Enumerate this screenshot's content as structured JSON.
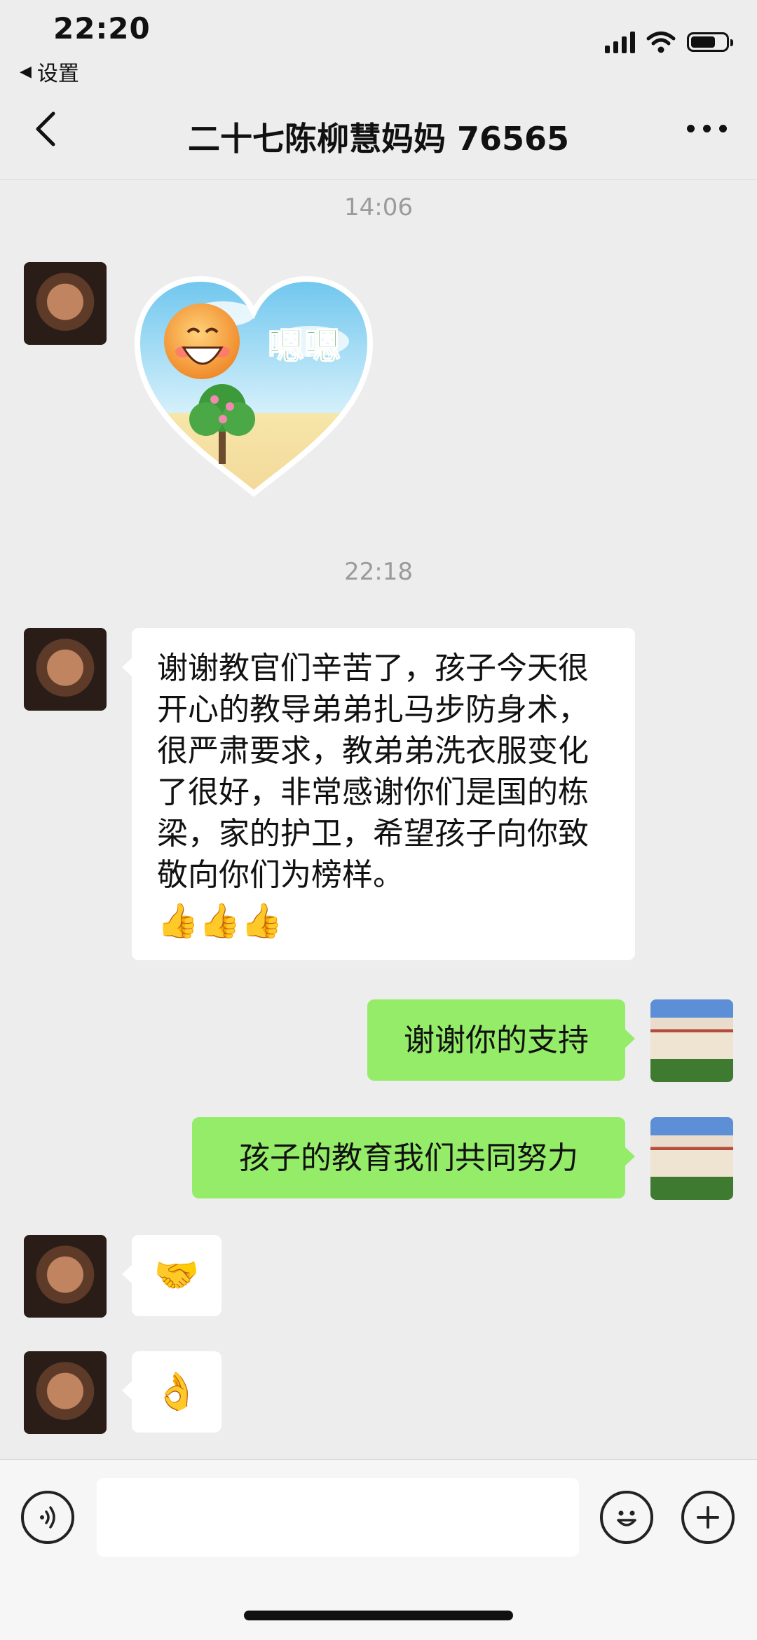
{
  "status_bar": {
    "time": "22:20",
    "back_app_label": "设置",
    "battery_level": 0.7
  },
  "nav": {
    "title": "二十七陈柳慧妈妈 76565"
  },
  "messages": {
    "ts1": "14:06",
    "sticker_text": "嗯嗯",
    "ts2": "22:18",
    "long_text": "谢谢教官们辛苦了，孩子今天很开心的教导弟弟扎马步防身术，很严肃要求，教弟弟洗衣服变化了很好，非常感谢你们是国的栋梁，家的护卫，希望孩子向你致敬向你们为榜样。",
    "long_emojis": "👍👍👍",
    "reply1": "谢谢你的支持",
    "reply2": "孩子的教育我们共同努力",
    "emoji_handshake": "🤝",
    "emoji_hand": "👌"
  },
  "input": {
    "value": ""
  },
  "colors": {
    "background": "#ededed",
    "sent_bubble": "#95ec69",
    "received_bubble": "#ffffff"
  }
}
